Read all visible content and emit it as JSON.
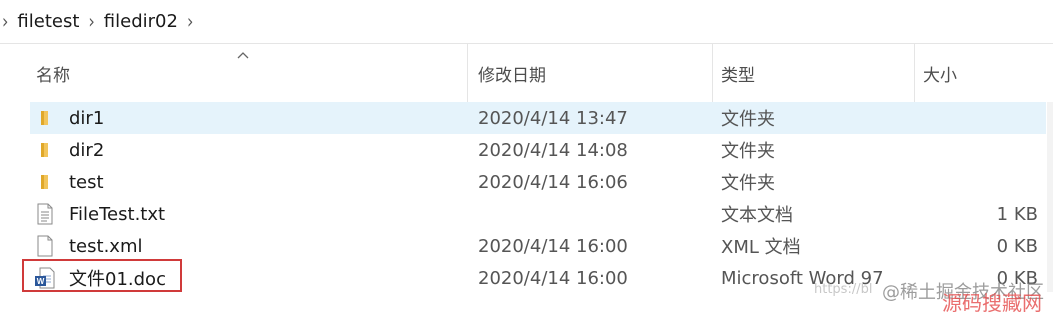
{
  "breadcrumb": {
    "items": [
      "filetest",
      "filedir02"
    ],
    "separator": "›"
  },
  "columns": {
    "name": "名称",
    "modified": "修改日期",
    "type": "类型",
    "size": "大小"
  },
  "files": [
    {
      "name": "dir1",
      "modified": "2020/4/14 13:47",
      "type": "文件夹",
      "size": "",
      "icon": "folder-icon",
      "selected": true
    },
    {
      "name": "dir2",
      "modified": "2020/4/14 14:08",
      "type": "文件夹",
      "size": "",
      "icon": "folder-icon"
    },
    {
      "name": "test",
      "modified": "2020/4/14 16:06",
      "type": "文件夹",
      "size": "",
      "icon": "folder-icon"
    },
    {
      "name": "FileTest.txt",
      "modified": "",
      "type": "文本文档",
      "size": "1 KB",
      "icon": "text-file-icon"
    },
    {
      "name": "test.xml",
      "modified": "2020/4/14 16:00",
      "type": "XML 文档",
      "size": "0 KB",
      "icon": "blank-file-icon"
    },
    {
      "name": "文件01.doc",
      "modified": "2020/4/14 16:00",
      "type": "Microsoft Word 97",
      "size": "0 KB",
      "icon": "word-doc-icon",
      "highlighted": true
    }
  ],
  "watermark": {
    "url_fragment": "https://bl",
    "site": "@稀土掘金技术社区",
    "overlay": "源码搜藏网"
  },
  "colors": {
    "selection": "#e5f3fb",
    "folder": "#f2c55c",
    "highlight_border": "#d03a3a",
    "word_blue": "#2b579a"
  }
}
